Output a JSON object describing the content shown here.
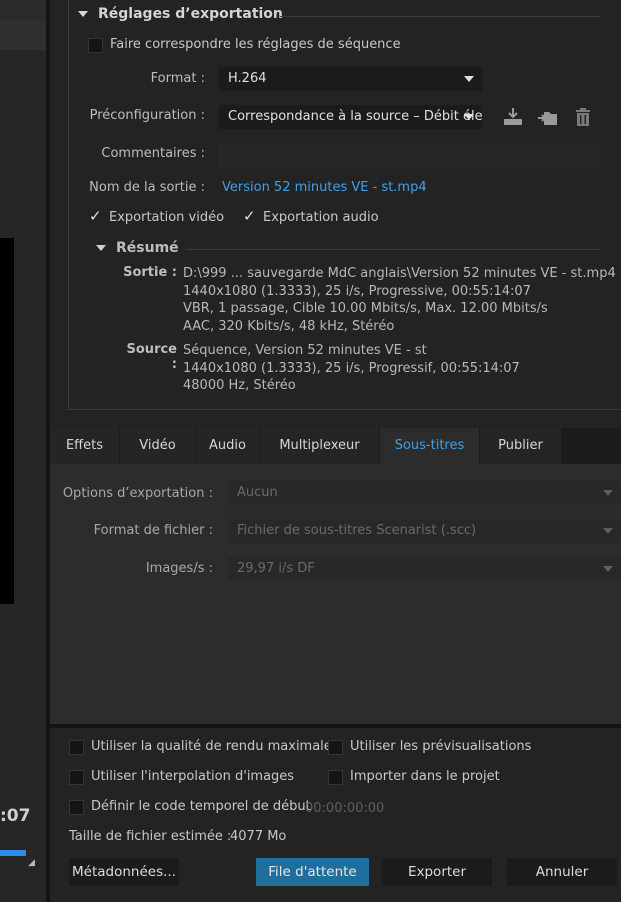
{
  "left_panel": {
    "timecode_fragment": ":07"
  },
  "export_settings": {
    "section_title": "Réglages d’exportation",
    "match_sequence_label": "Faire correspondre les réglages de séquence",
    "format_label": "Format :",
    "format_value": "H.264",
    "preset_label": "Préconfiguration :",
    "preset_value": "Correspondance à la source – Débit élevé",
    "comments_label": "Commentaires :",
    "comments_value": "",
    "output_name_label": "Nom de la sortie :",
    "output_name_value": "Version 52 minutes VE - st.mp4",
    "export_video_label": "Exportation vidéo",
    "export_audio_label": "Exportation audio",
    "export_video_checked": true,
    "export_audio_checked": true,
    "icons": [
      "save-preset-icon",
      "import-preset-icon",
      "trash-icon"
    ]
  },
  "summary": {
    "title": "Résumé",
    "output_label": "Sortie :",
    "output_lines": [
      "D:\\999 ... sauvegarde MdC anglais\\Version 52 minutes VE - st.mp4",
      "1440x1080 (1.3333), 25 i/s, Progressive, 00:55:14:07",
      "VBR, 1 passage, Cible 10.00  Mbits/s, Max. 12.00  Mbits/s",
      "AAC, 320  Kbits/s, 48  kHz, Stéréo"
    ],
    "source_label": "Source :",
    "source_lines": [
      "Séquence, Version 52 minutes VE - st",
      "1440x1080 (1.3333), 25  i/s, Progressif, 00:55:14:07",
      "48000 Hz, Stéréo"
    ]
  },
  "tabs": {
    "items": [
      "Effets",
      "Vidéo",
      "Audio",
      "Multiplexeur",
      "Sous-titres",
      "Publier"
    ],
    "active": "Sous-titres"
  },
  "subtitles": {
    "export_options_label": "Options d’exportation :",
    "export_options_value": "Aucun",
    "file_format_label": "Format de fichier :",
    "file_format_value": "Fichier de sous-titres Scenarist (.scc)",
    "frame_rate_label": "Images/s :",
    "frame_rate_value": "29,97 i/s DF"
  },
  "bottom": {
    "max_render_quality": "Utiliser la qualité de rendu maximale",
    "use_previews": "Utiliser les prévisualisations",
    "frame_blending": "Utiliser l'interpolation d'images",
    "import_into_project": "Importer dans le projet",
    "set_start_timecode": "Définir le code temporel de début",
    "start_timecode_value": "00:00:00:00",
    "estimated_size_label": "Taille de fichier estimée :",
    "estimated_size_value": "4077 Mo",
    "metadata_button": "Métadonnées...",
    "queue_button": "File d'attente",
    "export_button": "Exporter",
    "cancel_button": "Annuler"
  },
  "colors": {
    "accent_blue": "#3fa0e8",
    "primary_button": "#1f6f9e",
    "background": "#232323"
  }
}
